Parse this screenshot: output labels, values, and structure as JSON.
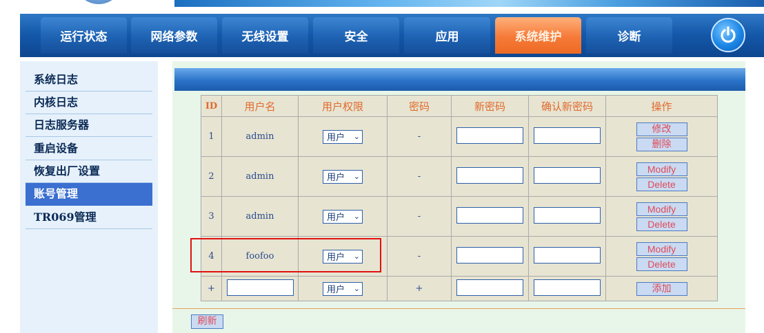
{
  "nav": {
    "tabs": [
      {
        "label": "运行状态"
      },
      {
        "label": "网络参数"
      },
      {
        "label": "无线设置"
      },
      {
        "label": "安全"
      },
      {
        "label": "应用"
      },
      {
        "label": "系统维护",
        "active": true
      },
      {
        "label": "诊断"
      }
    ],
    "power_icon": "power-icon"
  },
  "sidebar": {
    "items": [
      {
        "label": "系统日志"
      },
      {
        "label": "内核日志"
      },
      {
        "label": "日志服务器"
      },
      {
        "label": "重启设备"
      },
      {
        "label": "恢复出厂设置"
      },
      {
        "label": "账号管理",
        "active": true
      },
      {
        "label": "TR069管理"
      }
    ]
  },
  "table": {
    "headers": [
      "ID",
      "用户名",
      "用户权限",
      "密码",
      "新密码",
      "确认新密码",
      "操作"
    ],
    "rows": [
      {
        "id": "1",
        "username": "admin",
        "permission": "用户",
        "password": "-",
        "actions": [
          "修改",
          "删除"
        ]
      },
      {
        "id": "2",
        "username": "admin",
        "permission": "用户",
        "password": "-",
        "actions": [
          "Modify",
          "Delete"
        ]
      },
      {
        "id": "3",
        "username": "admin",
        "permission": "用户",
        "password": "-",
        "actions": [
          "Modify",
          "Delete"
        ]
      },
      {
        "id": "4",
        "username": "foofoo",
        "permission": "用户",
        "password": "-",
        "actions": [
          "Modify",
          "Delete"
        ]
      }
    ],
    "add_row": {
      "id": "+",
      "permission": "用户",
      "password": "+",
      "action": "添加"
    }
  },
  "refresh_label": "刷新",
  "colors": {
    "nav": "#1457a8",
    "active_tab": "#f57a38",
    "sidebar_active": "#3b6fd0",
    "highlight": "#e01010"
  }
}
